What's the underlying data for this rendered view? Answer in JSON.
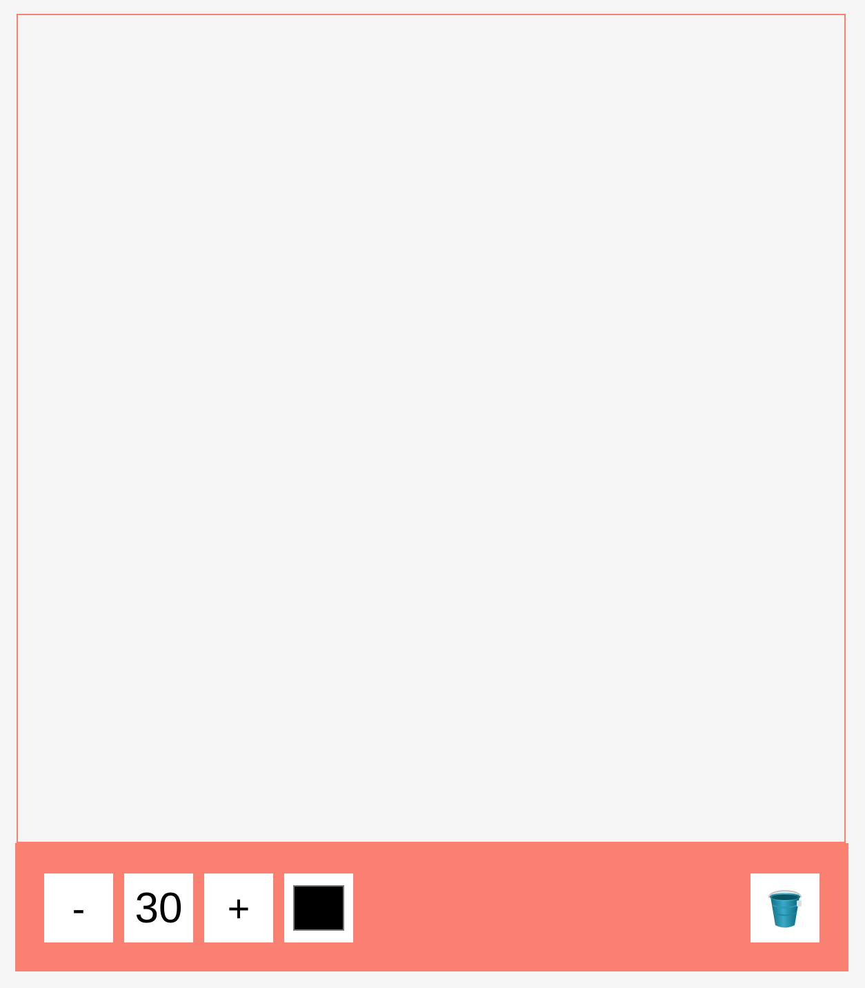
{
  "toolbar": {
    "decrease_label": "-",
    "size_value": "30",
    "increase_label": "+",
    "current_color": "#000000",
    "clear_icon": "bucket-icon"
  },
  "colors": {
    "accent": "#fa8072",
    "canvas_bg": "#f5f5f5",
    "button_bg": "#ffffff"
  }
}
